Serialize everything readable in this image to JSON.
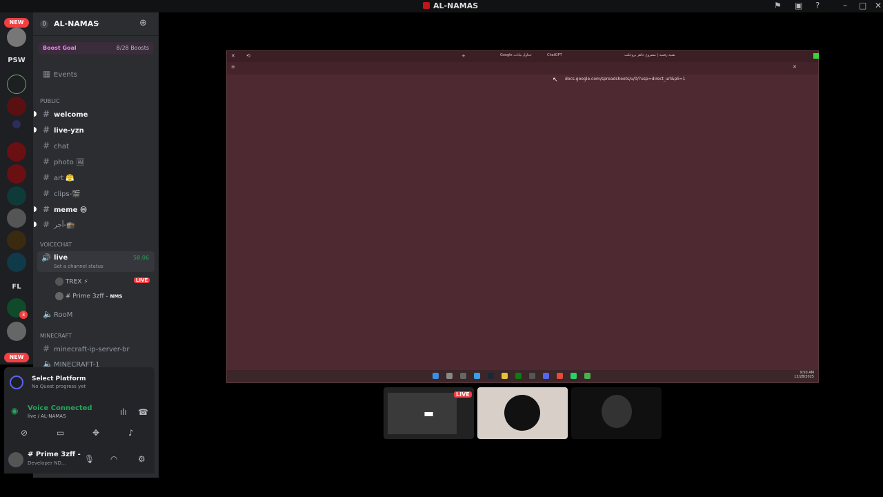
{
  "window": {
    "title": "AL-NAMAS"
  },
  "guilds": {
    "new_top": "NEW",
    "psw": "PSW",
    "fl": "FL",
    "new_bottom": "NEW",
    "badge_count": "3"
  },
  "server": {
    "zero_badge": "0",
    "name": "AL-NAMAS",
    "boost_label": "Boost Goal",
    "boost_progress": "8/28 Boosts"
  },
  "nav": {
    "events": "Events"
  },
  "categories": {
    "public": "public",
    "voicechat": "VOICECHAT",
    "minecraft": "MINECRAFT"
  },
  "channels": {
    "welcome": "welcome",
    "live_yzn": "live-yzn",
    "chat": "chat",
    "photo": "photo 🖼",
    "art": "art 😤",
    "clips": "clips-🎬",
    "meme": "meme 😄",
    "ajr": "أجر-🕋"
  },
  "voice": {
    "live_channel": "live",
    "live_timer": "58:06",
    "live_status": "Set a channel status",
    "user1": "TREX ⚡",
    "live_badge": "LIVE",
    "user2": "# Prime 3zff -",
    "user2_tag": "NMS",
    "room": "RooM"
  },
  "minecraft": {
    "ip": "minecraft-ip-server-br",
    "mc1": "MINECRAFT-1"
  },
  "quest": {
    "title": "Select Platform",
    "subtitle": "No Quest progress yet"
  },
  "voice_connection": {
    "status": "Voice Connected",
    "location": "live / AL-NAMAS"
  },
  "user": {
    "name": "# Prime 3zff -",
    "status": "Developer ND..."
  },
  "browser": {
    "tabs": [
      "Google جداول بيانات",
      "ChatGPT",
      "تقنية رقمية | مشروع جاهز بروجكت"
    ],
    "url": "docs.google.com/spreadsheets/u/0/?usp=direct_url&pli=1",
    "time": "9:50 AM",
    "date": "12/28/2025"
  },
  "stream_tiles": {
    "live_badge": "LIVE"
  },
  "colors": {
    "accent_red": "#f23f42",
    "voice_green": "#23a55a",
    "browser_bg": "#4f2931"
  }
}
